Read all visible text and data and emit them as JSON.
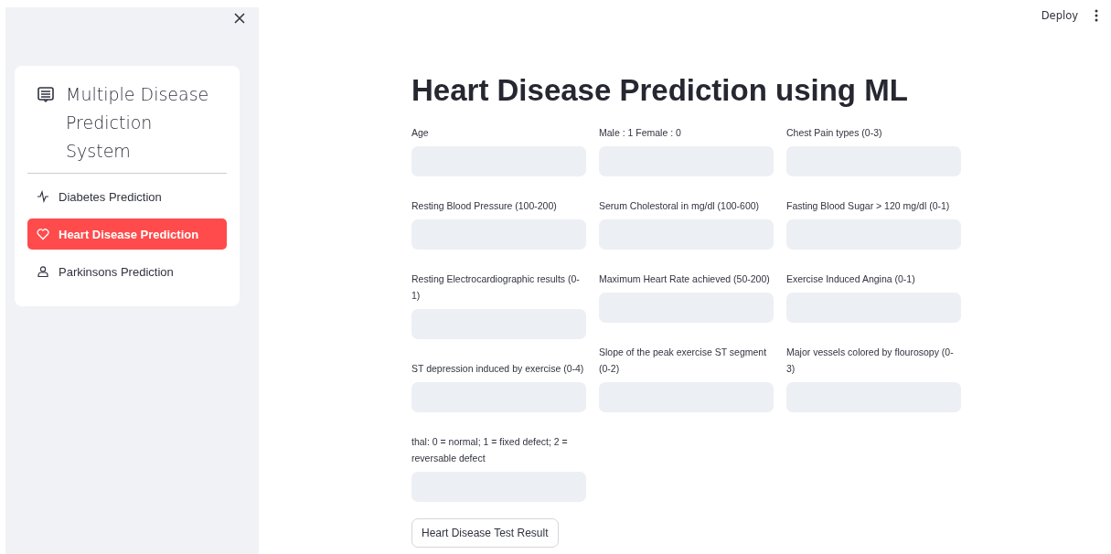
{
  "sidebar": {
    "title": "Multiple Disease Prediction System",
    "menu": [
      {
        "label": "Diabetes Prediction",
        "kind": "pulse",
        "selected": false
      },
      {
        "label": "Heart Disease Prediction",
        "kind": "heart",
        "selected": true
      },
      {
        "label": "Parkinsons Prediction",
        "kind": "person",
        "selected": false
      }
    ]
  },
  "header": {
    "deploy": "Deploy"
  },
  "title": "Heart Disease Prediction using ML",
  "columns": [
    {
      "fields": [
        {
          "label": "Age"
        },
        {
          "label": "Resting Blood Pressure (100-200)"
        },
        {
          "label": "Resting Electrocardiographic results (0-1)"
        },
        {
          "label": "ST depression induced by exercise (0-4)"
        },
        {
          "label": "thal: 0 = normal; 1 = fixed defect; 2 = reversable defect"
        }
      ]
    },
    {
      "fields": [
        {
          "label": "Male : 1 Female : 0"
        },
        {
          "label": "Serum Cholestoral in mg/dl (100-600)"
        },
        {
          "label": "Maximum Heart Rate achieved (50-200)"
        },
        {
          "label": "Slope of the peak exercise ST segment (0-2)"
        }
      ]
    },
    {
      "fields": [
        {
          "label": "Chest Pain types (0-3)"
        },
        {
          "label": "Fasting Blood Sugar > 120 mg/dl (0-1)"
        },
        {
          "label": "Exercise Induced Angina (0-1)"
        },
        {
          "label": "Major vessels colored by flourosopy (0-3)"
        }
      ]
    }
  ],
  "button": "Heart Disease Test Result"
}
